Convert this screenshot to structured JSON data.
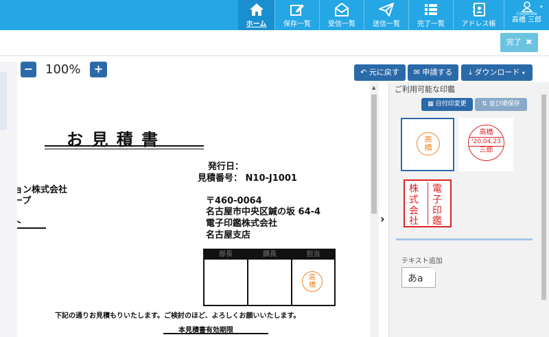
{
  "nav": {
    "items": [
      {
        "label": "ホーム",
        "icon": "home-icon"
      },
      {
        "label": "保存一覧",
        "icon": "edit-icon"
      },
      {
        "label": "受信一覧",
        "icon": "inbox-icon"
      },
      {
        "label": "送信一覧",
        "icon": "send-icon"
      },
      {
        "label": "完了一覧",
        "icon": "list-icon"
      },
      {
        "label": "アドレス帳",
        "icon": "address-book-icon"
      }
    ],
    "user": {
      "label": "高橋 三郎",
      "sub": "Corporate"
    }
  },
  "toolbar": {
    "done_label": "完了",
    "zoom_out": "−",
    "zoom_level": "100%",
    "zoom_in": "+",
    "undo_label": "元に戻す",
    "apply_label": "申請する",
    "download_label": "ダウンロード"
  },
  "document": {
    "title": "お 見 積 書",
    "issue_date_label": "発行日：",
    "quote_no": "見積番号： N10-J1001",
    "customer1": "ョン株式会社",
    "customer2": "ープ",
    "customer3": "ト",
    "postal": "〒460-0064",
    "address": "名古屋市中央区鍼の坂 64-4",
    "company": "電子印鑑株式会社",
    "branch": "名古屋支店",
    "stamp_headers": [
      "部長",
      "課長",
      "担当"
    ],
    "stamp_name": [
      "高",
      "橋"
    ],
    "message": "下記の通りお見積もりいたします。ご検討のほど、よろしくお願いいたします。",
    "validity": "本見積書有効期限"
  },
  "panel": {
    "title": "ご利用可能な印鑑",
    "date_stamp_btn": "日付印変更",
    "sort_save_btn": "並び順保存",
    "seal1": [
      "高",
      "橋"
    ],
    "seal2": {
      "top": "高橋",
      "date": "'20.04.23",
      "bottom": "三郎"
    },
    "seal3": [
      "電",
      "子",
      "印",
      "鑑",
      "株",
      "式",
      "会",
      "社"
    ],
    "text_add_label": "テキスト追加",
    "text_sample": "あa",
    "collapse_arrow": "›"
  },
  "colors": {
    "nav": "#25a6e5",
    "button": "#2b6aa9",
    "seal_orange": "#f0801e",
    "seal_red": "#e02020"
  }
}
